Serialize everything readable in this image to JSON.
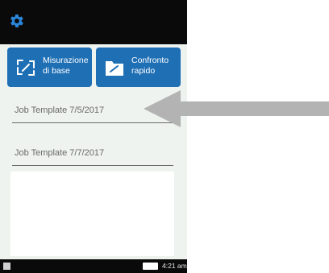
{
  "header": {
    "settings_icon": "gear-icon"
  },
  "buttons": {
    "misurazione": {
      "label": "Misurazione\ndi base",
      "icon": "measure-icon"
    },
    "confronto": {
      "label": "Confronto\nrapido",
      "icon": "folder-icon"
    }
  },
  "jobs": [
    {
      "name": "Job Template 7/5/2017"
    },
    {
      "name": "Job Template 7/7/2017"
    }
  ],
  "status": {
    "time": "4:21 am",
    "battery_icon": "battery-icon"
  },
  "colors": {
    "primary": "#1f6fb5",
    "accent": "#2a86d8",
    "arrow": "#b3b3b3"
  }
}
